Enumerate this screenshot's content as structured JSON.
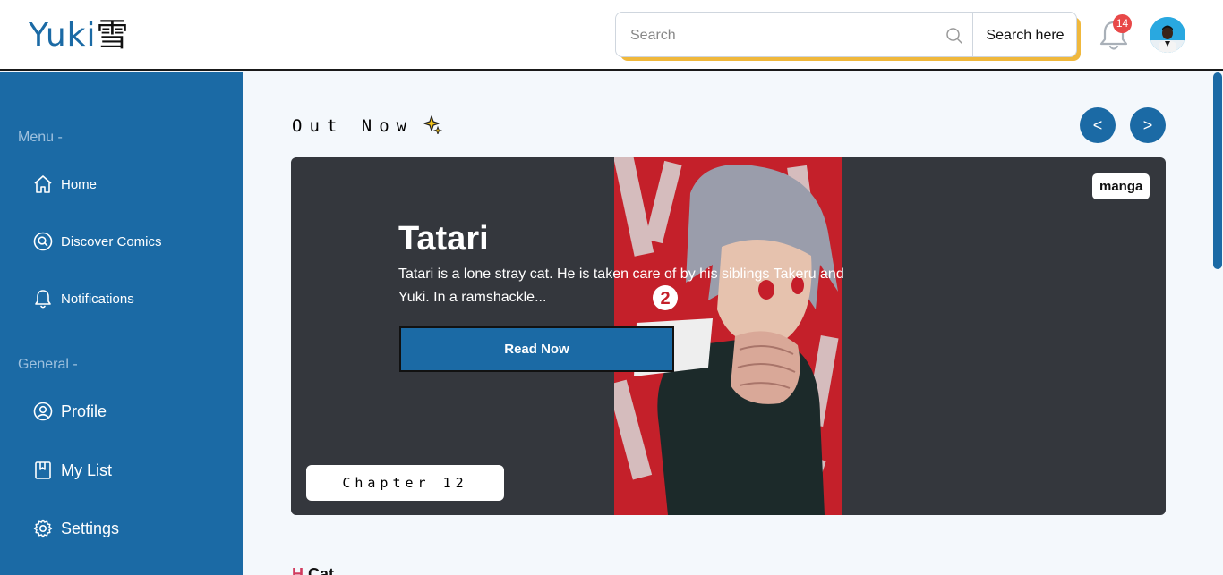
{
  "header": {
    "logo_text": "Yuki",
    "logo_kanji": "雪",
    "search_placeholder": "Search",
    "search_button": "Search here",
    "notification_count": "14"
  },
  "sidebar": {
    "menu_heading": "Menu -",
    "menu_items": [
      {
        "label": "Home",
        "icon": "home-icon"
      },
      {
        "label": "Discover Comics",
        "icon": "search-circle-icon"
      },
      {
        "label": "Notifications",
        "icon": "bell-icon"
      }
    ],
    "general_heading": "General -",
    "general_items": [
      {
        "label": "Profile",
        "icon": "user-circle-icon"
      },
      {
        "label": "My List",
        "icon": "book-icon"
      },
      {
        "label": "Settings",
        "icon": "gear-icon"
      }
    ]
  },
  "main": {
    "section_title": "Out Now",
    "prev_label": "<",
    "next_label": ">",
    "featured": {
      "tag": "manga",
      "title": "Tatari",
      "description": "Tatari is a lone stray cat. He is taken care of by his siblings Takeru and Yuki. In a ramshackle...",
      "read_button": "Read Now",
      "chapter": "Chapter 12",
      "cover_number": "2"
    },
    "next_section_accent": "H",
    "next_section_title": "Cat"
  },
  "colors": {
    "brand": "#1b6aa5",
    "search_accent": "#f0b83c",
    "badge": "#e84848",
    "card_bg": "#34373d",
    "cover_red": "#c4202a"
  }
}
